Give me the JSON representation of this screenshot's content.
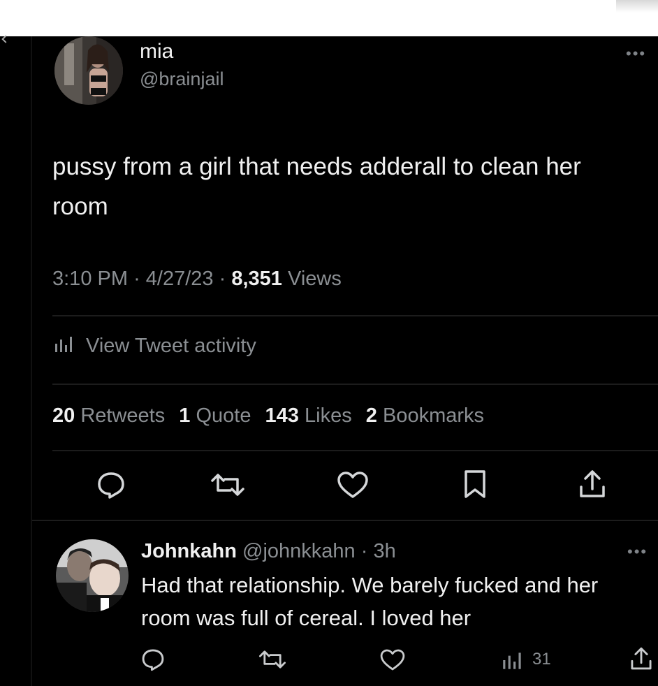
{
  "tweet": {
    "author_name": "mia",
    "author_handle": "@brainjail",
    "text": "pussy from a girl that needs adderall to clean her room",
    "time": "3:10 PM",
    "date": "4/27/23",
    "views_count": "8,351",
    "views_label": "Views",
    "activity_label": "View Tweet activity",
    "retweets_count": "20",
    "retweets_label": "Retweets",
    "quotes_count": "1",
    "quotes_label": "Quote",
    "likes_count": "143",
    "likes_label": "Likes",
    "bookmarks_count": "2",
    "bookmarks_label": "Bookmarks",
    "dot": "·",
    "more": "•••"
  },
  "reply": {
    "author_name": "Johnkahn",
    "author_handle": "@johnkkahn",
    "age": "3h",
    "text": "Had that relationship. We barely fucked and her room was full of cereal. I loved her",
    "views_count": "31",
    "dot": "·",
    "more": "•••"
  },
  "icons": {
    "reply": "speech-bubble-icon",
    "retweet": "retweet-icon",
    "like": "heart-icon",
    "bookmark": "bookmark-icon",
    "share": "share-icon",
    "analytics": "bar-chart-icon"
  },
  "colors": {
    "background": "#000000",
    "text": "#e7e9ea",
    "secondary": "#8b8f93",
    "divider": "#1c1c1c"
  }
}
